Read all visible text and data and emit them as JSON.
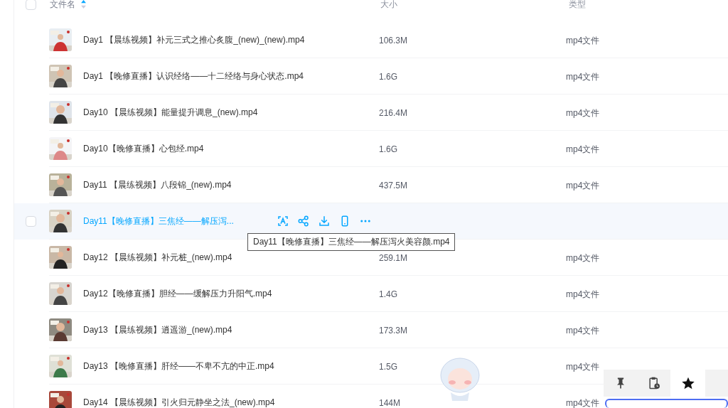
{
  "table": {
    "header": {
      "checkbox": {
        "checked": false
      },
      "columns": [
        {
          "label": "文件名",
          "sorted": true
        },
        {
          "label": "大小",
          "sorted": false
        },
        {
          "label": "类型",
          "sorted": false
        }
      ]
    },
    "rows": [
      {
        "name": "Day1 【晨练视频】补元三式之推心炙腹_(new)_(new).mp4",
        "size": "106.3M",
        "type": "mp4文件",
        "hovered": false
      },
      {
        "name": "Day1 【晚修直播】认识经络——十二经络与身心状态.mp4",
        "size": "1.6G",
        "type": "mp4文件",
        "hovered": false
      },
      {
        "name": "Day10 【晨练视频】能量提升调息_(new).mp4",
        "size": "216.4M",
        "type": "mp4文件",
        "hovered": false
      },
      {
        "name": "Day10【晚修直播】心包经.mp4",
        "size": "1.6G",
        "type": "mp4文件",
        "hovered": false
      },
      {
        "name": "Day11 【晨练视频】八段锦_(new).mp4",
        "size": "437.5M",
        "type": "mp4文件",
        "hovered": false
      },
      {
        "name": "Day11【晚修直播】三焦经——解压泻...",
        "hovered": true,
        "checkbox": {
          "checked": false
        },
        "actions": [
          {
            "kind": "text-scan"
          },
          {
            "kind": "share"
          },
          {
            "kind": "download"
          },
          {
            "kind": "phone"
          },
          {
            "kind": "more"
          }
        ]
      },
      {
        "name": "Day12 【晨练视频】补元桩_(new).mp4",
        "size": "259.1M",
        "type": "mp4文件",
        "hovered": false
      },
      {
        "name": "Day12【晚修直播】胆经——缓解压力升阳气.mp4",
        "size": "1.4G",
        "type": "mp4文件",
        "hovered": false
      },
      {
        "name": "Day13 【晨练视频】逍遥游_(new).mp4",
        "size": "173.3M",
        "type": "mp4文件",
        "hovered": false
      },
      {
        "name": "Day13 【晚修直播】肝经——不卑不亢的中正.mp4",
        "size": "1.5G",
        "type": "mp4文件",
        "hovered": false
      },
      {
        "name": "Day14 【晨练视频】引火归元静坐之法_(new).mp4",
        "size": "144M",
        "type": "mp4文件",
        "hovered": false
      }
    ]
  },
  "tooltip": {
    "text": "Day11【晚修直播】三焦经——解压泻火美容颜.mp4"
  },
  "assistant_toolbar": {
    "buttons": [
      {
        "kind": "pin",
        "selected": false
      },
      {
        "kind": "clipboard",
        "selected": false
      },
      {
        "kind": "star",
        "selected": true
      }
    ]
  }
}
